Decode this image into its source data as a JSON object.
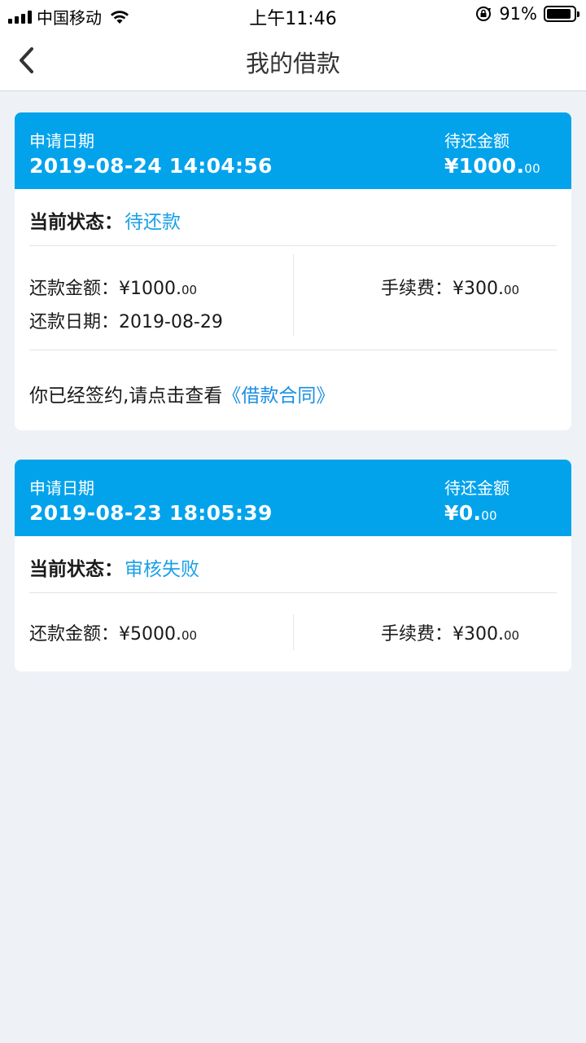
{
  "status_bar": {
    "carrier": "中国移动",
    "time": "上午11:46",
    "battery": "91%",
    "battery_level": 0.91
  },
  "nav": {
    "title": "我的借款"
  },
  "loans": [
    {
      "apply_date_label": "申请日期",
      "apply_date": "2019-08-24 14:04:56",
      "pending_label": "待还金额",
      "pending_main": "¥1000.",
      "pending_dec": "00",
      "status_label": "当前状态：",
      "status_value": "待还款",
      "repay_amount_label": "还款金额：",
      "repay_amount_main": "¥1000.",
      "repay_amount_dec": "00",
      "fee_label": "手续费：",
      "fee_main": "¥300.",
      "fee_dec": "00",
      "repay_date_label": "还款日期：",
      "repay_date": "2019-08-29",
      "contract_text": "你已经签约,请点击查看",
      "contract_link": "《借款合同》"
    },
    {
      "apply_date_label": "申请日期",
      "apply_date": "2019-08-23 18:05:39",
      "pending_label": "待还金额",
      "pending_main": "¥0.",
      "pending_dec": "00",
      "status_label": "当前状态：",
      "status_value": "审核失败",
      "repay_amount_label": "还款金额：",
      "repay_amount_main": "¥5000.",
      "repay_amount_dec": "00",
      "fee_label": "手续费：",
      "fee_main": "¥300.",
      "fee_dec": "00"
    }
  ],
  "colors": {
    "header_blue": "#03a3ec",
    "link_blue": "#1aa0e8",
    "background": "#eef2f7"
  }
}
